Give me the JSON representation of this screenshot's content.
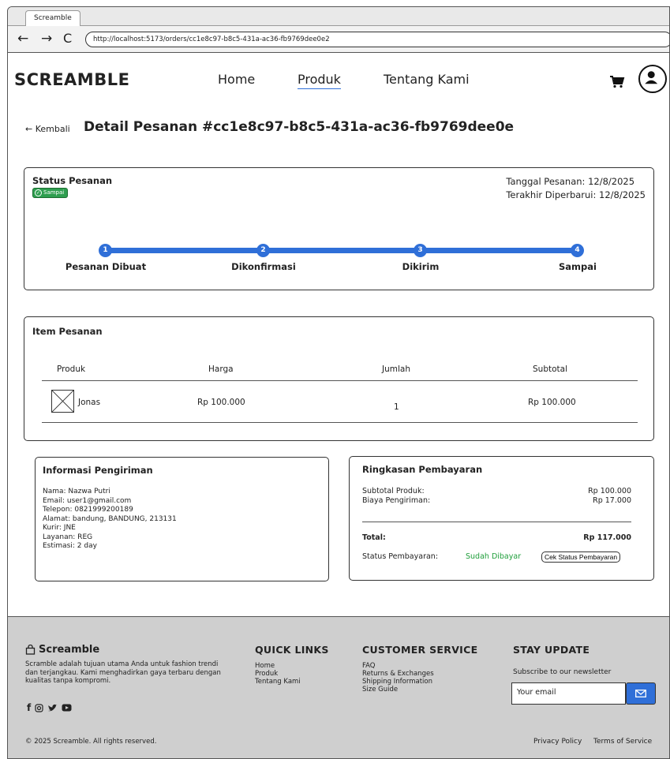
{
  "browser": {
    "tab_title": "Screamble",
    "url": "http://localhost:5173/orders/cc1e8c97-b8c5-431a-ac36-fb9769dee0e2"
  },
  "header": {
    "logo": "SCREAMBLE",
    "nav": [
      "Home",
      "Produk",
      "Tentang Kami"
    ],
    "active_nav": "Produk"
  },
  "order": {
    "back_label": "← Kembali",
    "title": "Detail Pesanan #cc1e8c97-b8c5-431a-ac36-fb9769dee0e"
  },
  "status": {
    "heading": "Status Pesanan",
    "badge": "Sampai",
    "tanggal_pesanan": "Tanggal Pesanan: 12/8/2025",
    "terakhir_diperbarui": "Terakhir Diperbarui: 12/8/2025",
    "steps": [
      {
        "num": "1",
        "label": "Pesanan Dibuat"
      },
      {
        "num": "2",
        "label": "Dikonfirmasi"
      },
      {
        "num": "3",
        "label": "Dikirim"
      },
      {
        "num": "4",
        "label": "Sampai"
      }
    ]
  },
  "items": {
    "heading": "Item Pesanan",
    "columns": [
      "Produk",
      "Harga",
      "Jumlah",
      "Subtotal"
    ],
    "rows": [
      {
        "produk": "Jonas",
        "harga": "Rp 100.000",
        "jumlah": "1",
        "subtotal": "Rp 100.000"
      }
    ]
  },
  "shipping": {
    "heading": "Informasi Pengiriman",
    "lines": [
      "Nama: Nazwa Putri",
      "Email: user1@gmail.com",
      "Telepon: 0821999200189",
      "Alamat: bandung, BANDUNG, 213131",
      "Kurir: JNE",
      "Layanan: REG",
      "Estimasi: 2 day"
    ]
  },
  "payment": {
    "heading": "Ringkasan Pembayaran",
    "subtotal_label": "Subtotal Produk:",
    "subtotal_value": "Rp 100.000",
    "ongkir_label": "Biaya Pengiriman:",
    "ongkir_value": "Rp 17.000",
    "total_label": "Total:",
    "total_value": "Rp 117.000",
    "status_label": "Status Pembayaran:",
    "status_value": "Sudah Dibayar",
    "status_color": "#1e9e3a",
    "check_button": "Cek Status Pembayaran"
  },
  "footer": {
    "brand": "Screamble",
    "description": "Scramble adalah tujuan utama Anda untuk fashion trendi dan terjangkau. Kami menghadirkan gaya terbaru dengan kualitas tanpa kompromi.",
    "quick_links_heading": "QUICK LINKS",
    "quick_links": [
      "Home",
      "Produk",
      "Tentang Kami"
    ],
    "customer_service_heading": "CUSTOMER SERVICE",
    "customer_service": [
      "FAQ",
      "Returns & Exchanges",
      "Shipping Information",
      "Size Guide"
    ],
    "stay_update_heading": "STAY UPDATE",
    "newsletter_text": "Subscribe to our newsletter",
    "email_placeholder": "Your email",
    "copyright": "© 2025 Screamble. All rights reserved.",
    "privacy": "Privacy Policy",
    "terms": "Terms of Service"
  },
  "colors": {
    "accent": "#2f6fd8",
    "badge_green": "#2e9e4f",
    "footer_bg": "#cfcfcf"
  }
}
